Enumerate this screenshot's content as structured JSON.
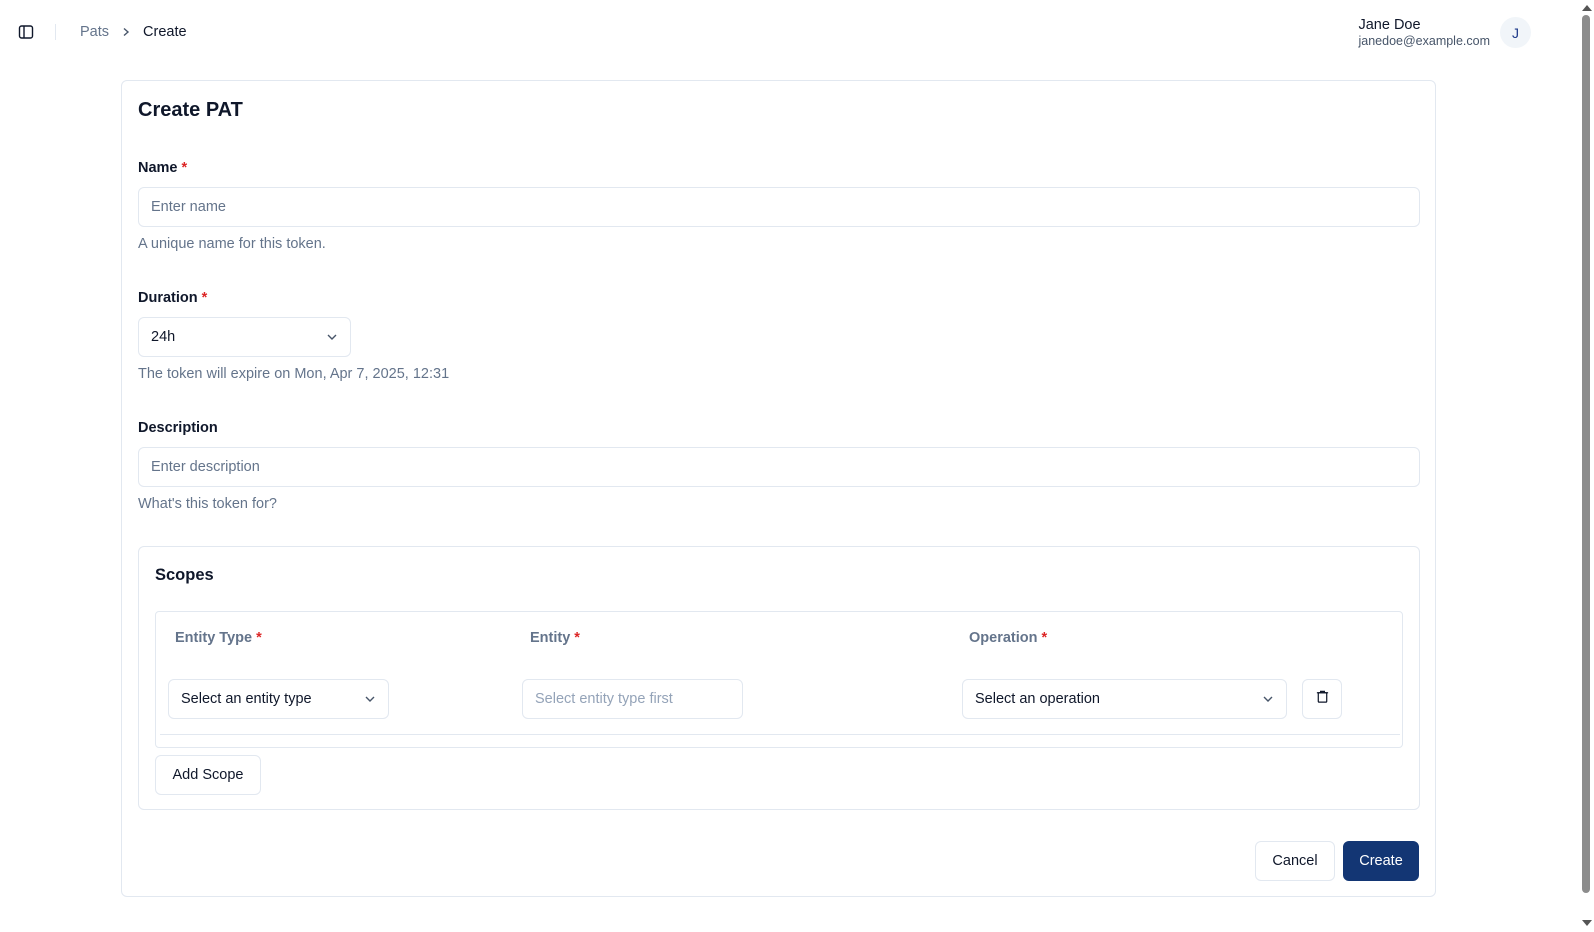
{
  "header": {
    "breadcrumb": {
      "parent": "Pats",
      "current": "Create"
    },
    "user": {
      "name": "Jane Doe",
      "email": "janedoe@example.com",
      "initial": "J"
    }
  },
  "form": {
    "title": "Create PAT",
    "name": {
      "label": "Name",
      "required_mark": "*",
      "placeholder": "Enter name",
      "value": "",
      "hint": "A unique name for this token."
    },
    "duration": {
      "label": "Duration",
      "required_mark": "*",
      "value": "24h",
      "hint": "The token will expire on Mon, Apr 7, 2025, 12:31"
    },
    "description": {
      "label": "Description",
      "placeholder": "Enter description",
      "value": "",
      "hint": "What's this token for?"
    },
    "scopes": {
      "title": "Scopes",
      "columns": {
        "entity_type": "Entity Type",
        "entity": "Entity",
        "operation": "Operation",
        "required_mark": "*"
      },
      "row": {
        "entity_type_placeholder": "Select an entity type",
        "entity_placeholder": "Select entity type first",
        "operation_placeholder": "Select an operation"
      },
      "add_label": "Add Scope"
    },
    "actions": {
      "cancel": "Cancel",
      "create": "Create"
    }
  },
  "colors": {
    "primary": "#133674",
    "required": "#dc2626",
    "muted_text": "#64748b",
    "border": "#e2e8f0"
  }
}
